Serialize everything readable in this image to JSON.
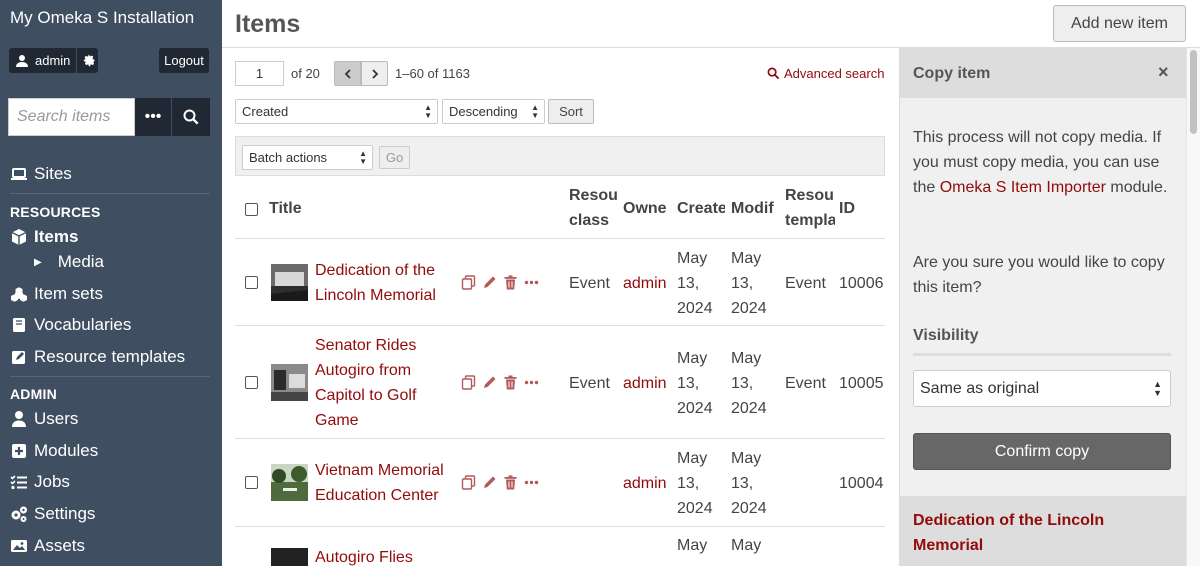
{
  "app": {
    "installation_title": "My Omeka S Installation",
    "user_name": "admin",
    "logout_label": "Logout",
    "search_placeholder": "Search items",
    "search_more_label": "•••"
  },
  "sidebar": {
    "sites_label": "Sites",
    "resources_heading": "RESOURCES",
    "items_label": "Items",
    "media_label": "Media",
    "item_sets_label": "Item sets",
    "vocabularies_label": "Vocabularies",
    "resource_templates_label": "Resource templates",
    "admin_heading": "ADMIN",
    "users_label": "Users",
    "modules_label": "Modules",
    "jobs_label": "Jobs",
    "settings_label": "Settings",
    "assets_label": "Assets"
  },
  "header": {
    "page_title": "Items",
    "add_new_label": "Add new item"
  },
  "pagination": {
    "current_page": "1",
    "of_text": "of 20",
    "range_text": "1–60 of 1163",
    "advanced_search_label": "Advanced search"
  },
  "sorting": {
    "sort_by": "Created",
    "sort_order": "Descending",
    "sort_button": "Sort"
  },
  "batch": {
    "selected_action": "Batch actions",
    "go_label": "Go"
  },
  "table": {
    "headers": {
      "title": "Title",
      "resource_class": "Resou class",
      "owner": "Owne",
      "created": "Create",
      "modified": "Modif",
      "resource_template": "Resou templa",
      "id": "ID"
    },
    "rows": [
      {
        "title": "Dedication of the Lincoln Memorial",
        "resource_class": "Event",
        "owner": "admin",
        "created": "May 13, 2024",
        "modified": "May 13, 2024",
        "resource_template": "Event",
        "id": "10006"
      },
      {
        "title": "Senator Rides Autogiro from Capitol to Golf Game",
        "resource_class": "Event",
        "owner": "admin",
        "created": "May 13, 2024",
        "modified": "May 13, 2024",
        "resource_template": "Event",
        "id": "10005"
      },
      {
        "title": "Vietnam Memorial Education Center",
        "resource_class": "",
        "owner": "admin",
        "created": "May 13, 2024",
        "modified": "May 13, 2024",
        "resource_template": "",
        "id": "10004"
      },
      {
        "title": "Autogiro Flies",
        "resource_class": "",
        "owner": "",
        "created": "May",
        "modified": "May",
        "resource_template": "",
        "id": ""
      }
    ]
  },
  "copy_panel": {
    "title": "Copy item",
    "close_label": "×",
    "message_before_link": "This process will not copy media. If you must copy media, you can use the ",
    "importer_link": "Omeka S Item Importer",
    "message_after_link": " module.",
    "confirm_question": "Are you sure you would like to copy this item?",
    "visibility_label": "Visibility",
    "visibility_value": "Same as original",
    "confirm_button": "Confirm copy",
    "item_title": "Dedication of the Lincoln Memorial"
  },
  "colors": {
    "sidebar_bg": "#404e61",
    "link": "#920b0b",
    "confirm_bg": "#676767"
  }
}
